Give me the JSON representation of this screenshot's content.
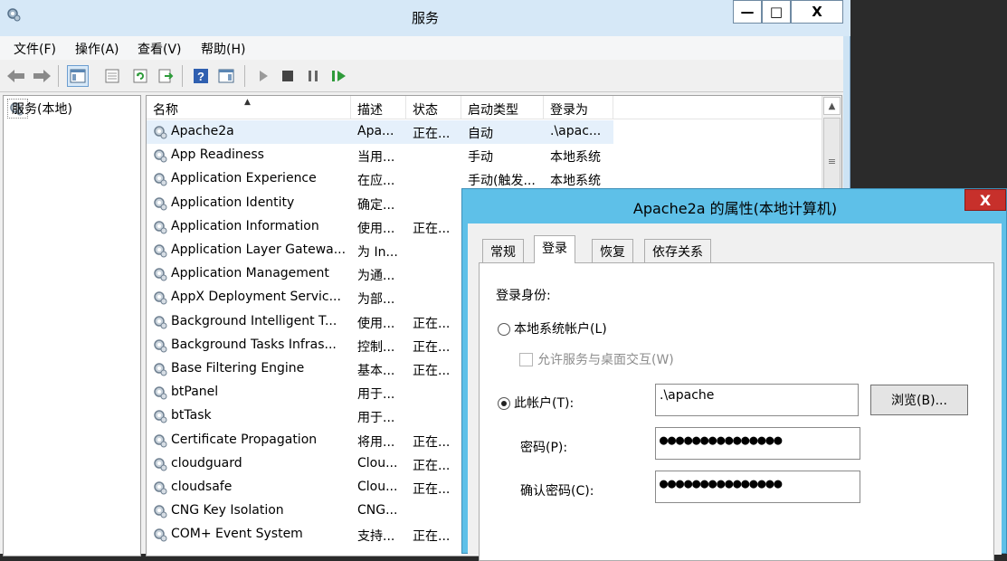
{
  "services_window": {
    "title": "服务",
    "caption_buttons": {
      "minimize": "—",
      "maximize": "□",
      "close": "X"
    },
    "menu": [
      "文件(F)",
      "操作(A)",
      "查看(V)",
      "帮助(H)"
    ],
    "toolbar_icons": [
      "back-arrow-icon",
      "forward-arrow-icon",
      "show-hide-console-tree-icon",
      "properties-icon",
      "refresh-icon",
      "export-list-icon",
      "help-icon",
      "show-action-pane-icon",
      "start-service-icon",
      "stop-service-icon",
      "pause-service-icon",
      "restart-service-icon"
    ],
    "tree": {
      "root_label": "服务(本地)"
    },
    "columns": [
      "名称",
      "描述",
      "状态",
      "启动类型",
      "登录为"
    ],
    "rows": [
      {
        "name": "Apache2a",
        "desc": "Apa...",
        "status": "正在...",
        "startup": "自动",
        "logon": ".\\apac...",
        "selected": true
      },
      {
        "name": "App Readiness",
        "desc": "当用...",
        "status": "",
        "startup": "手动",
        "logon": "本地系统"
      },
      {
        "name": "Application Experience",
        "desc": "在应...",
        "status": "",
        "startup": "手动(触发...",
        "logon": "本地系统"
      },
      {
        "name": "Application Identity",
        "desc": "确定...",
        "status": "",
        "startup": "",
        "logon": ""
      },
      {
        "name": "Application Information",
        "desc": "使用...",
        "status": "正在...",
        "startup": "",
        "logon": ""
      },
      {
        "name": "Application Layer Gatewa...",
        "desc": "为 In...",
        "status": "",
        "startup": "",
        "logon": ""
      },
      {
        "name": "Application Management",
        "desc": "为通...",
        "status": "",
        "startup": "",
        "logon": ""
      },
      {
        "name": "AppX Deployment Servic...",
        "desc": "为部...",
        "status": "",
        "startup": "",
        "logon": ""
      },
      {
        "name": "Background Intelligent T...",
        "desc": "使用...",
        "status": "正在...",
        "startup": "",
        "logon": ""
      },
      {
        "name": "Background Tasks Infras...",
        "desc": "控制...",
        "status": "正在...",
        "startup": "",
        "logon": ""
      },
      {
        "name": "Base Filtering Engine",
        "desc": "基本...",
        "status": "正在...",
        "startup": "",
        "logon": ""
      },
      {
        "name": "btPanel",
        "desc": "用于...",
        "status": "",
        "startup": "",
        "logon": ""
      },
      {
        "name": "btTask",
        "desc": "用于...",
        "status": "",
        "startup": "",
        "logon": ""
      },
      {
        "name": "Certificate Propagation",
        "desc": "将用...",
        "status": "正在...",
        "startup": "",
        "logon": ""
      },
      {
        "name": "cloudguard",
        "desc": "Clou...",
        "status": "正在...",
        "startup": "",
        "logon": ""
      },
      {
        "name": "cloudsafe",
        "desc": "Clou...",
        "status": "正在...",
        "startup": "",
        "logon": ""
      },
      {
        "name": "CNG Key Isolation",
        "desc": "CNG...",
        "status": "",
        "startup": "",
        "logon": ""
      },
      {
        "name": "COM+ Event System",
        "desc": "支持...",
        "status": "正在...",
        "startup": "",
        "logon": ""
      }
    ]
  },
  "dialog": {
    "title": "Apache2a 的属性(本地计算机)",
    "close_label": "X",
    "tabs": [
      {
        "label": "常规",
        "active": false
      },
      {
        "label": "登录",
        "active": true
      },
      {
        "label": "恢复",
        "active": false
      },
      {
        "label": "依存关系",
        "active": false
      }
    ],
    "logon_as_label": "登录身份:",
    "local_system_label": "本地系统帐户(L)",
    "local_system_selected": false,
    "allow_desktop_label": "允许服务与桌面交互(W)",
    "allow_desktop_checked": false,
    "this_account_label": "此帐户(T):",
    "this_account_selected": true,
    "account_value": ".\\apache",
    "browse_label": "浏览(B)...",
    "password_label": "密码(P):",
    "password_value": "●●●●●●●●●●●●●●●",
    "confirm_label": "确认密码(C):",
    "confirm_value": "●●●●●●●●●●●●●●●"
  }
}
